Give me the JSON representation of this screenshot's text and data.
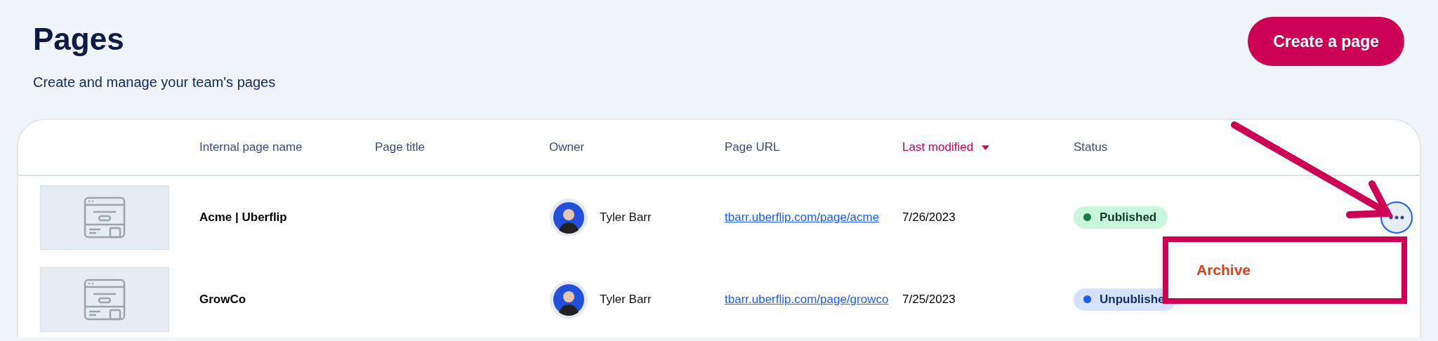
{
  "header": {
    "title": "Pages",
    "subtitle": "Create and manage your team's pages",
    "create_button": "Create a page"
  },
  "table": {
    "columns": [
      {
        "label": "Internal page name",
        "sorted": false
      },
      {
        "label": "Page title",
        "sorted": false
      },
      {
        "label": "Owner",
        "sorted": false
      },
      {
        "label": "Page URL",
        "sorted": false
      },
      {
        "label": "Last modified",
        "sorted": true
      },
      {
        "label": "Status",
        "sorted": false
      }
    ],
    "rows": [
      {
        "name": "Acme | Uberflip",
        "owner": "Tyler Barr",
        "url": "tbarr.uberflip.com/page/acme",
        "modified": "7/26/2023",
        "status": {
          "label": "Published",
          "kind": "published",
          "color": "#1e7a45"
        },
        "menu_open": true
      },
      {
        "name": "GrowCo",
        "owner": "Tyler Barr",
        "url": "tbarr.uberflip.com/page/growco",
        "modified": "7/25/2023",
        "status": {
          "label": "Unpublishe",
          "kind": "unpublished",
          "color": "#1a5cff"
        },
        "menu_open": false
      }
    ]
  },
  "row_menu": {
    "items": [
      "Archive"
    ]
  }
}
